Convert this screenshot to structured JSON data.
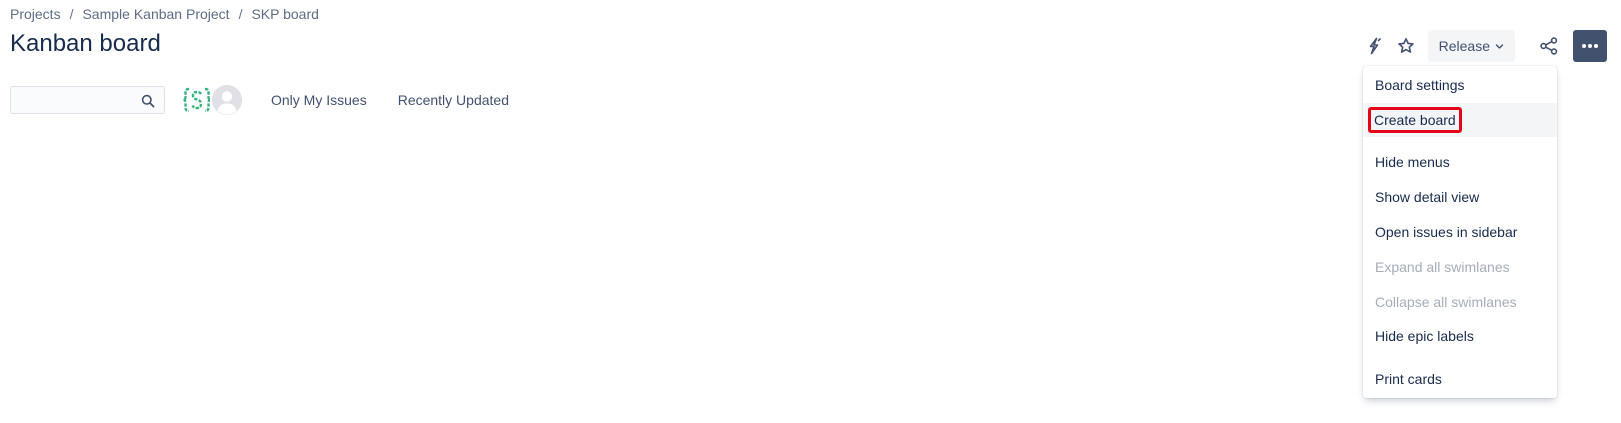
{
  "breadcrumbs": {
    "items": [
      "Projects",
      "Sample Kanban Project",
      "SKP board"
    ],
    "separator": "/"
  },
  "title": "Kanban board",
  "toolbar": {
    "release_label": "Release",
    "icons": [
      "lightning-icon",
      "star-icon",
      "chevron-down-icon",
      "share-icon",
      "more-icon"
    ]
  },
  "filters": {
    "search_value": "",
    "search_icon": "search-icon",
    "avatar_icons": [
      "code-avatar",
      "user-avatar"
    ],
    "quick_filters": [
      "Only My Issues",
      "Recently Updated"
    ]
  },
  "menu": {
    "items": [
      {
        "label": "Board settings",
        "enabled": true
      },
      {
        "label": "Create board",
        "enabled": true,
        "highlighted": true
      },
      {
        "label": "Hide menus",
        "enabled": true
      },
      {
        "label": "Show detail view",
        "enabled": true
      },
      {
        "label": "Open issues in sidebar",
        "enabled": true
      },
      {
        "label": "Expand all swimlanes",
        "enabled": false
      },
      {
        "label": "Collapse all swimlanes",
        "enabled": false
      },
      {
        "label": "Hide epic labels",
        "enabled": true
      },
      {
        "label": "Print cards",
        "enabled": true
      }
    ]
  },
  "colors": {
    "text_primary": "#172B4D",
    "text_secondary": "#42526E",
    "more_button_bg": "#42526E",
    "release_button_bg": "#F4F5F7",
    "disabled_text": "#A5ADBA",
    "highlight_border": "#E5001A",
    "avatar_green": "#36B37E"
  }
}
